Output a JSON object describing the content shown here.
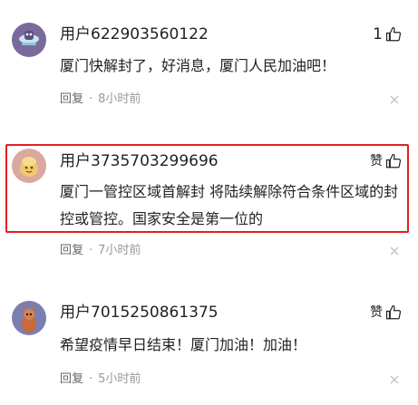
{
  "comments": [
    {
      "username": "用户622903560122",
      "like_count": "1",
      "like_label": "",
      "content": "厦门快解封了，好消息，厦门人民加油吧！",
      "reply_label": "回复",
      "separator": "·",
      "time": "8小时前",
      "avatar_colors": {
        "bg": "#7a6a9c",
        "fg": "#c9e4f2"
      },
      "highlighted": false
    },
    {
      "username": "用户3735703299696",
      "like_count": "",
      "like_label": "赞",
      "content": "厦门一管控区域首解封 将陆续解除符合条件区域的封控或管控。国家安全是第一位的",
      "reply_label": "回复",
      "separator": "·",
      "time": "7小时前",
      "avatar_colors": {
        "bg": "#d9a9a0",
        "fg": "#f0c86a"
      },
      "highlighted": true
    },
    {
      "username": "用户7015250861375",
      "like_count": "",
      "like_label": "赞",
      "content": "希望疫情早日结束！厦门加油！加油！",
      "reply_label": "回复",
      "separator": "·",
      "time": "5小时前",
      "avatar_colors": {
        "bg": "#7a7fb0",
        "fg": "#c86a3a"
      },
      "highlighted": false
    }
  ],
  "colors": {
    "highlight_border": "#e02020",
    "meta_text": "#999999",
    "body_text": "#222222"
  }
}
